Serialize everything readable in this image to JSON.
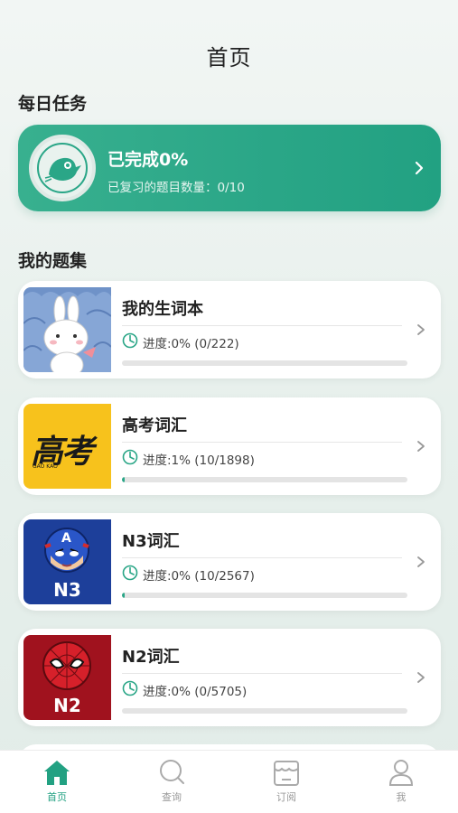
{
  "header": {
    "title": "首页"
  },
  "daily": {
    "section_title": "每日任务",
    "completed_label": "已完成0%",
    "progress_fraction": 0,
    "review_text": "已复习的题目数量：0/10"
  },
  "sets": {
    "section_title": "我的题集",
    "items": [
      {
        "name": "我的生词本",
        "progress_text": "进度:0% (0/222)",
        "progress_fraction": 0.0,
        "cover": "bunny-cover"
      },
      {
        "name": "高考词汇",
        "progress_text": "进度:1% (10/1898)",
        "progress_fraction": 0.0053,
        "cover": "gaokao-cover",
        "cover_text": "高考",
        "cover_subtext": "GAO KAO"
      },
      {
        "name": "N3词汇",
        "progress_text": "进度:0% (10/2567)",
        "progress_fraction": 0.0039,
        "cover": "captain-cover",
        "cover_text": "N3",
        "badge_letter": "A"
      },
      {
        "name": "N2词汇",
        "progress_text": "进度:0% (0/5705)",
        "progress_fraction": 0.0,
        "cover": "spider-cover",
        "cover_text": "N2"
      }
    ]
  },
  "tabbar": {
    "tabs": [
      {
        "label": "首页",
        "icon": "home-icon",
        "active": true
      },
      {
        "label": "查询",
        "icon": "search-icon",
        "active": false
      },
      {
        "label": "订阅",
        "icon": "store-icon",
        "active": false
      },
      {
        "label": "我",
        "icon": "person-icon",
        "active": false
      }
    ]
  },
  "colors": {
    "accent": "#2aa687",
    "bar_track": "#e4e4e4",
    "gaokao_yellow": "#f7c21c",
    "captain_blue": "#1d3f9a",
    "spider_red": "#a0121e"
  }
}
